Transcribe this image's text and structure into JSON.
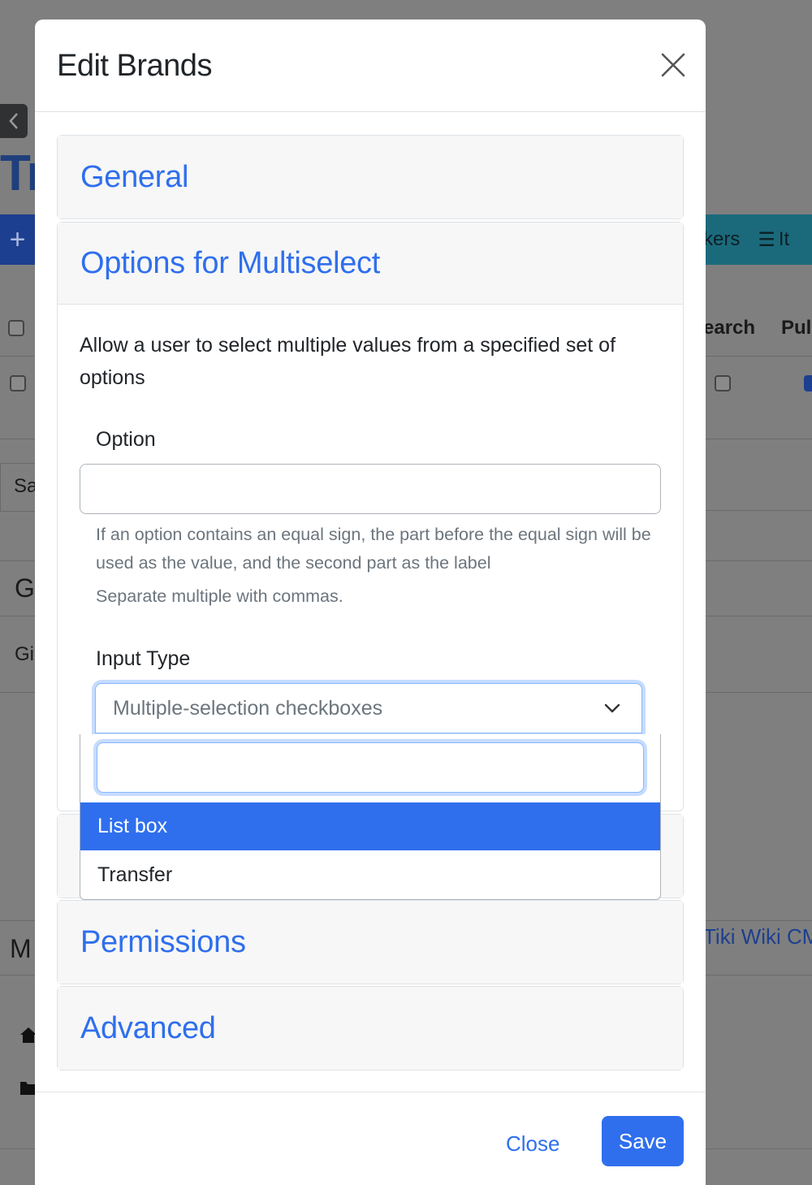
{
  "background": {
    "title_fragment": "Tr",
    "add_glyph": "+",
    "teal_bar_text": "kers",
    "teal_bar_fragment": "It",
    "header_fragment_1": "earch",
    "header_fragment_2": "Pul",
    "sa_fragment": "Sa",
    "g_fragment": "G",
    "gi_fragment": "Gi",
    "m_fragment": "M",
    "link_fragment": "Tiki Wiki CM"
  },
  "modal": {
    "title": "Edit Brands",
    "close_icon": "close-icon",
    "sections": {
      "general": "General",
      "options": "Options for Multiselect",
      "permissions": "Permissions",
      "advanced": "Advanced"
    },
    "options_body": {
      "description": "Allow a user to select multiple values from a specified set of options",
      "option_label": "Option",
      "option_value": "",
      "help_1": "If an option contains an equal sign, the part before the equal sign will be used as the value, and the second part as the label",
      "help_2": "Separate multiple with commas.",
      "input_type_label": "Input Type",
      "input_type_value": "Multiple-selection checkboxes"
    },
    "dropdown": {
      "search_value": "",
      "options": [
        "List box",
        "Transfer"
      ],
      "active_index": 0
    },
    "footer": {
      "close_label": "Close",
      "save_label": "Save"
    }
  },
  "colors": {
    "accent": "#2f6fed",
    "overlay": "#7f7f7f"
  }
}
